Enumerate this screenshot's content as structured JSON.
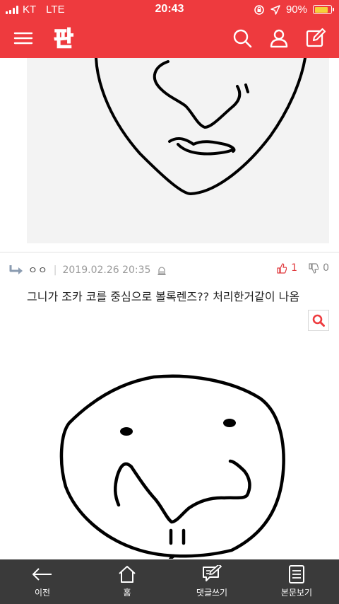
{
  "status_bar": {
    "carrier": "KT",
    "network": "LTE",
    "time": "20:43",
    "battery": "90%",
    "battery_level": 0.9
  },
  "header": {
    "logo_text": "판",
    "icons": [
      "menu-icon",
      "search-icon",
      "user-icon",
      "write-icon"
    ]
  },
  "comment": {
    "author": "ㅇㅇ",
    "datetime": "2019.02.26 20:35",
    "likes": "1",
    "dislikes": "0",
    "text": "그니가 조카 코를 중심으로 볼록렌즈?? 처리한거같이 나옴"
  },
  "bottom_nav": {
    "items": [
      {
        "label": "이전",
        "icon": "back-arrow-icon"
      },
      {
        "label": "홈",
        "icon": "home-icon"
      },
      {
        "label": "댓글쓰기",
        "icon": "write-comment-icon"
      },
      {
        "label": "본문보기",
        "icon": "document-icon"
      }
    ]
  },
  "colors": {
    "brand": "#ee3a3e",
    "nav_bg": "#3a3a3a",
    "like": "#e0373b"
  }
}
